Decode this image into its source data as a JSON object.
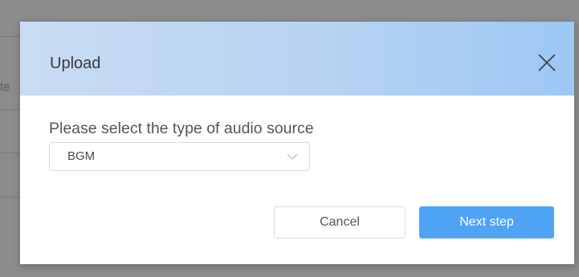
{
  "background": {
    "partial_text": "te"
  },
  "dialog": {
    "title": "Upload",
    "close_icon": "close-icon",
    "field_label": "Please select the type of audio source",
    "select": {
      "value": "BGM",
      "icon": "chevron-down-icon"
    },
    "buttons": {
      "cancel": "Cancel",
      "next": "Next step"
    }
  },
  "colors": {
    "primary": "#4ea3f5",
    "header_gradient_start": "#c9dcf3",
    "header_gradient_end": "#9dc7f4",
    "overlay": "#8c8c8c"
  }
}
